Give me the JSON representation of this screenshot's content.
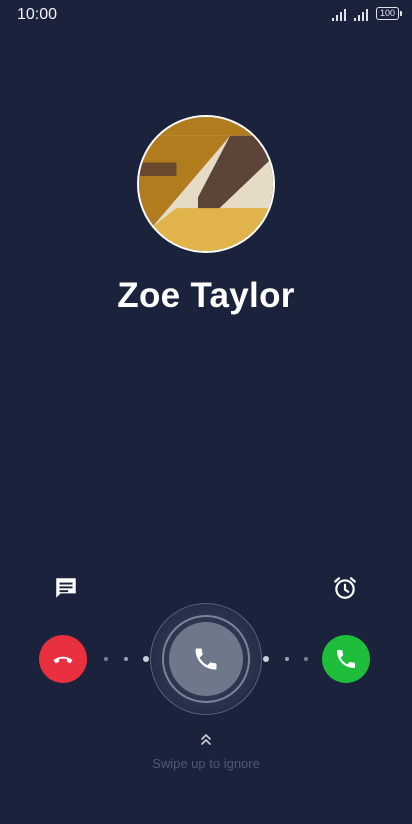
{
  "status_bar": {
    "time": "10:00",
    "battery_level": "100",
    "icons": [
      "cellular-signal-icon",
      "cellular-signal-icon",
      "battery-icon"
    ]
  },
  "caller": {
    "name": "Zoe Taylor"
  },
  "actions": {
    "message_icon": "message-icon",
    "alarm_icon": "alarm-clock-icon",
    "decline_icon": "phone-hangup-icon",
    "answer_icon": "phone-icon",
    "handle_icon": "phone-icon",
    "swipe_hint": "Swipe up to ignore",
    "swipe_icon": "double-chevron-up-icon"
  },
  "colors": {
    "background": "#1a233b",
    "decline": "#e8303e",
    "answer": "#1ebe3a",
    "handle": "#6f778b",
    "hint_text": "#4e5872"
  }
}
